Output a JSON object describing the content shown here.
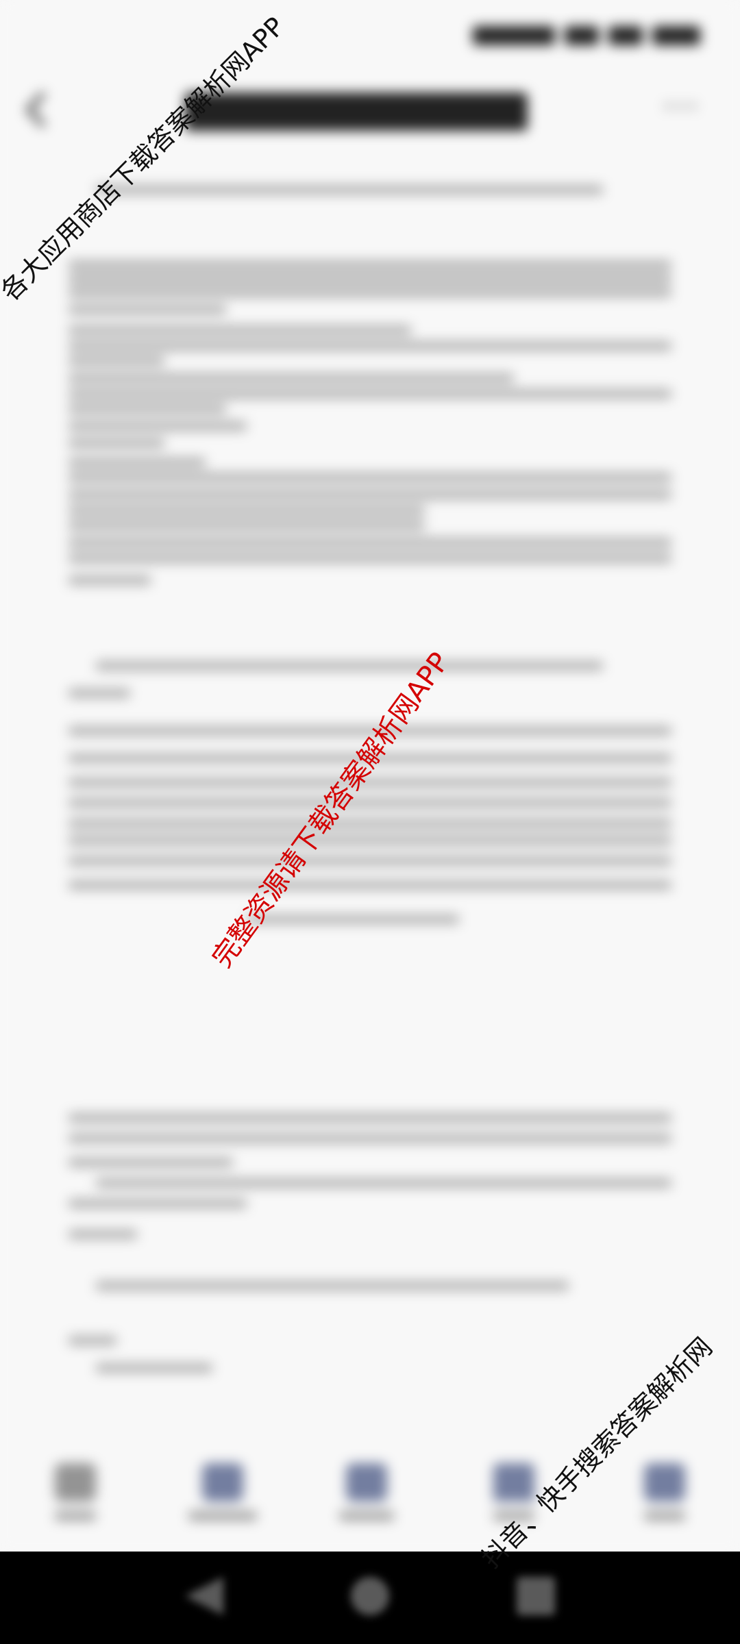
{
  "status_bar": {
    "time": ""
  },
  "header": {
    "title": ""
  },
  "toolbar": {
    "items": [
      {
        "icon": "pen-icon"
      },
      {
        "icon": "print-icon"
      },
      {
        "icon": "bookmark-icon"
      },
      {
        "icon": "share-icon"
      },
      {
        "icon": "download-icon"
      }
    ]
  },
  "watermarks": {
    "top_left": "各大应用商店下载答案解析网APP",
    "center": "完整资源请下载答案解析网APP",
    "bottom_right": "抖音、快手搜索答案解析网"
  },
  "nav_bar": {
    "buttons": [
      "back",
      "home",
      "recent"
    ]
  }
}
